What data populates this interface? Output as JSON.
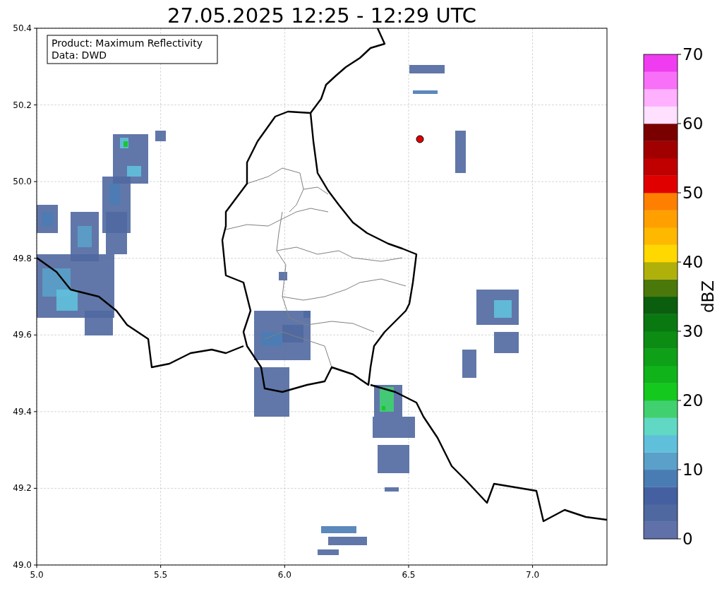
{
  "title": "27.05.2025 12:25 - 12:29 UTC",
  "info_box": [
    "Product: Maximum Reflectivity",
    "Data: DWD"
  ],
  "x_ticks": [
    "5.0",
    "5.5",
    "6.0",
    "6.5",
    "7.0"
  ],
  "y_ticks": [
    "50.4",
    "50.2",
    "50.0",
    "49.8",
    "49.6",
    "49.4",
    "49.2",
    "49.0"
  ],
  "colorbar": {
    "label": "dBZ",
    "ticks": [
      "70",
      "60",
      "50",
      "40",
      "30",
      "20",
      "10",
      "0"
    ],
    "colors": [
      {
        "color": "#6070a8"
      },
      {
        "color": "#5068a0"
      },
      {
        "color": "#4460a0"
      },
      {
        "color": "#4a7cb4"
      },
      {
        "color": "#5aa0c8"
      },
      {
        "color": "#60c0dc"
      },
      {
        "color": "#60d8c4"
      },
      {
        "color": "#40d070"
      },
      {
        "color": "#14c81e"
      },
      {
        "color": "#10b41a"
      },
      {
        "color": "#0ea016"
      },
      {
        "color": "#0c8c12"
      },
      {
        "color": "#0a7810"
      },
      {
        "color": "#0a5e0e"
      },
      {
        "color": "#4a780a"
      },
      {
        "color": "#b0b00a"
      },
      {
        "color": "#ffd800"
      },
      {
        "color": "#ffb800"
      },
      {
        "color": "#ffa000"
      },
      {
        "color": "#ff8000"
      },
      {
        "color": "#e00000"
      },
      {
        "color": "#c00000"
      },
      {
        "color": "#a00000"
      },
      {
        "color": "#7a0000"
      },
      {
        "color": "#ffe0ff"
      },
      {
        "color": "#ffb0ff"
      },
      {
        "color": "#f870f8"
      },
      {
        "color": "#f03cf0"
      }
    ]
  }
}
